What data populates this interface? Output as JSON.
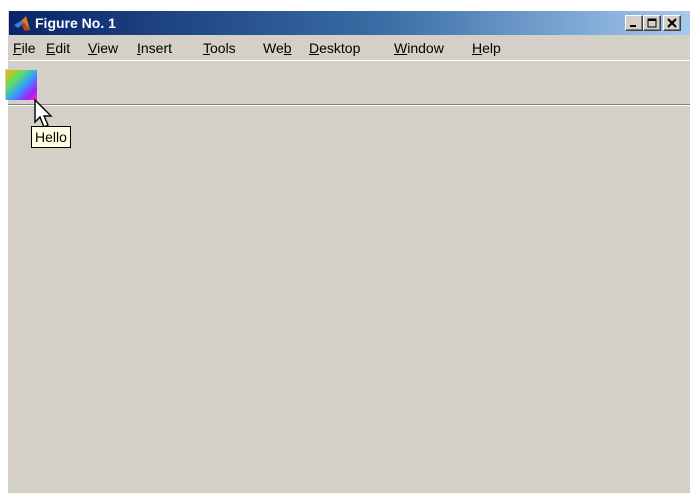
{
  "window": {
    "title": "Figure No. 1",
    "app_icon": "matlab-logo-icon",
    "controls": [
      {
        "name": "minimize-button",
        "icon": "minimize-icon"
      },
      {
        "name": "maximize-button",
        "icon": "maximize-icon"
      },
      {
        "name": "close-button",
        "icon": "close-icon"
      }
    ]
  },
  "menubar": {
    "items": [
      {
        "pre": "",
        "mn": "F",
        "post": "ile"
      },
      {
        "pre": "",
        "mn": "E",
        "post": "dit"
      },
      {
        "pre": "",
        "mn": "V",
        "post": "iew"
      },
      {
        "pre": "",
        "mn": "I",
        "post": "nsert"
      },
      {
        "pre": "",
        "mn": "T",
        "post": "ools"
      },
      {
        "pre": "We",
        "mn": "b",
        "post": ""
      },
      {
        "pre": "",
        "mn": "D",
        "post": "esktop"
      },
      {
        "pre": "",
        "mn": "W",
        "post": "indow"
      },
      {
        "pre": "",
        "mn": "H",
        "post": "elp"
      }
    ]
  },
  "toolbar": {
    "button_icon": "color-gradient-icon",
    "tooltip": "Hello"
  },
  "colors": {
    "titlebar_start": "#0a246a",
    "titlebar_end": "#a6caf0",
    "window_bg": "#d4d0c8",
    "tooltip_bg": "#ffffe1"
  }
}
